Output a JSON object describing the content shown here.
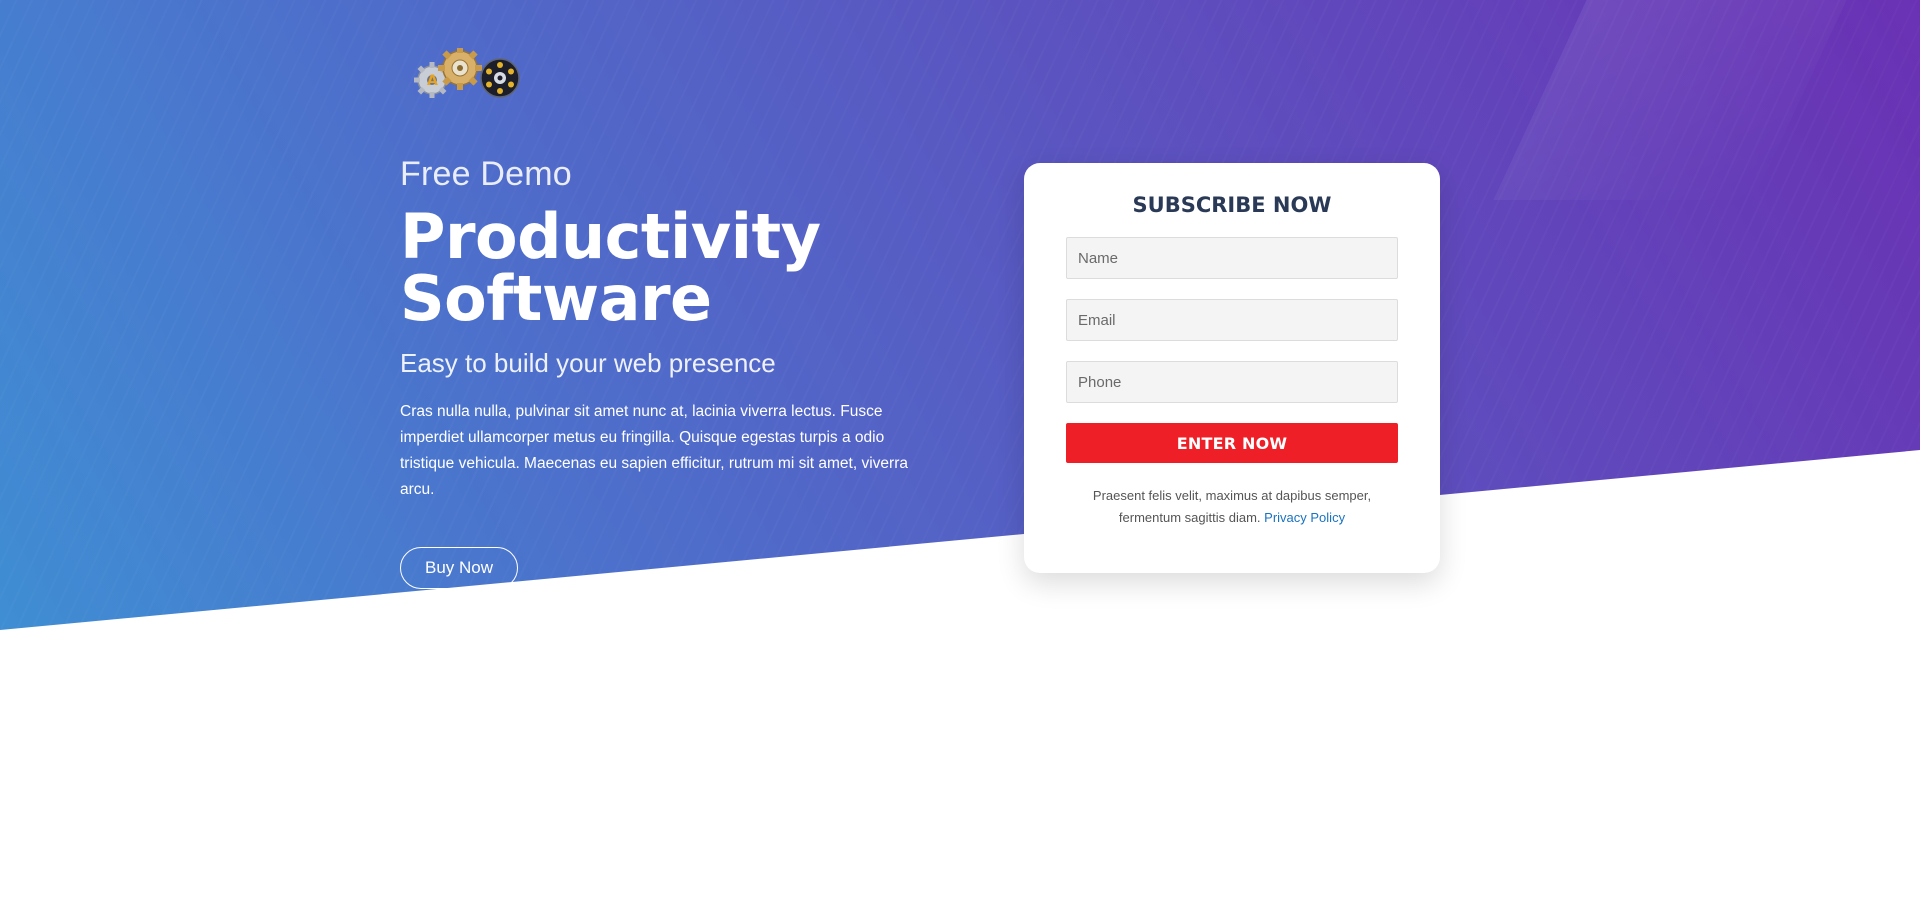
{
  "hero": {
    "eyebrow": "Free Demo",
    "headline_line1": "Productivity",
    "headline_line2": "Software",
    "subheadline": "Easy to build your web presence",
    "body": "Cras nulla nulla, pulvinar sit amet nunc at, lacinia viverra lectus. Fusce imperdiet ullamcorper metus eu fringilla. Quisque egestas turpis a odio tristique vehicula. Maecenas eu sapien efficitur, rutrum mi sit amet, viverra arcu.",
    "buy_button_label": "Buy Now"
  },
  "subscribe_card": {
    "title": "SUBSCRIBE NOW",
    "name_placeholder": "Name",
    "email_placeholder": "Email",
    "phone_placeholder": "Phone",
    "submit_label": "ENTER NOW",
    "note": "Praesent felis velit, maximus at dapibus semper, fermentum sagittis diam.",
    "privacy_link_label": "Privacy Policy"
  },
  "colors": {
    "gradient_start": "#3f8ed3",
    "gradient_end": "#6a31b4",
    "cta_red": "#ee1f26",
    "card_title": "#2a3a56",
    "link_blue": "#1a73c0"
  },
  "icons": {
    "logo": "gears-logo-icon"
  }
}
